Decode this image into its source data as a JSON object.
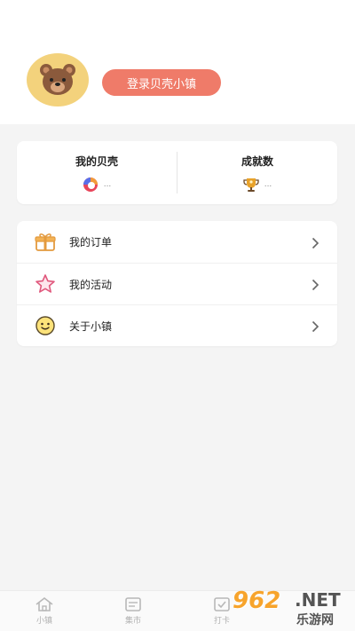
{
  "profile": {
    "login_label": "登录贝壳小镇",
    "avatar_icon": "bear-icon"
  },
  "stats": {
    "shells_label": "我的贝壳",
    "shells_value": "...",
    "shells_icon": "shell-icon",
    "achievements_label": "成就数",
    "achievements_value": "...",
    "achievements_icon": "trophy-icon"
  },
  "menu": {
    "items": [
      {
        "label": "我的订单",
        "icon": "gift-icon"
      },
      {
        "label": "我的活动",
        "icon": "star-icon"
      },
      {
        "label": "关于小镇",
        "icon": "smiley-icon"
      }
    ]
  },
  "tabbar": {
    "tabs": [
      {
        "label": "小镇",
        "icon": "home-icon"
      },
      {
        "label": "集市",
        "icon": "market-icon"
      },
      {
        "label": "打卡",
        "icon": "checkin-icon"
      },
      {
        "label": "",
        "icon": ""
      }
    ]
  },
  "watermark": {
    "number": "962",
    "suffix": ".NET",
    "cn": "乐游网"
  },
  "colors": {
    "accent": "#ef7b69",
    "avatar_bg": "#f3d27c",
    "page_bg": "#f4f4f4"
  }
}
